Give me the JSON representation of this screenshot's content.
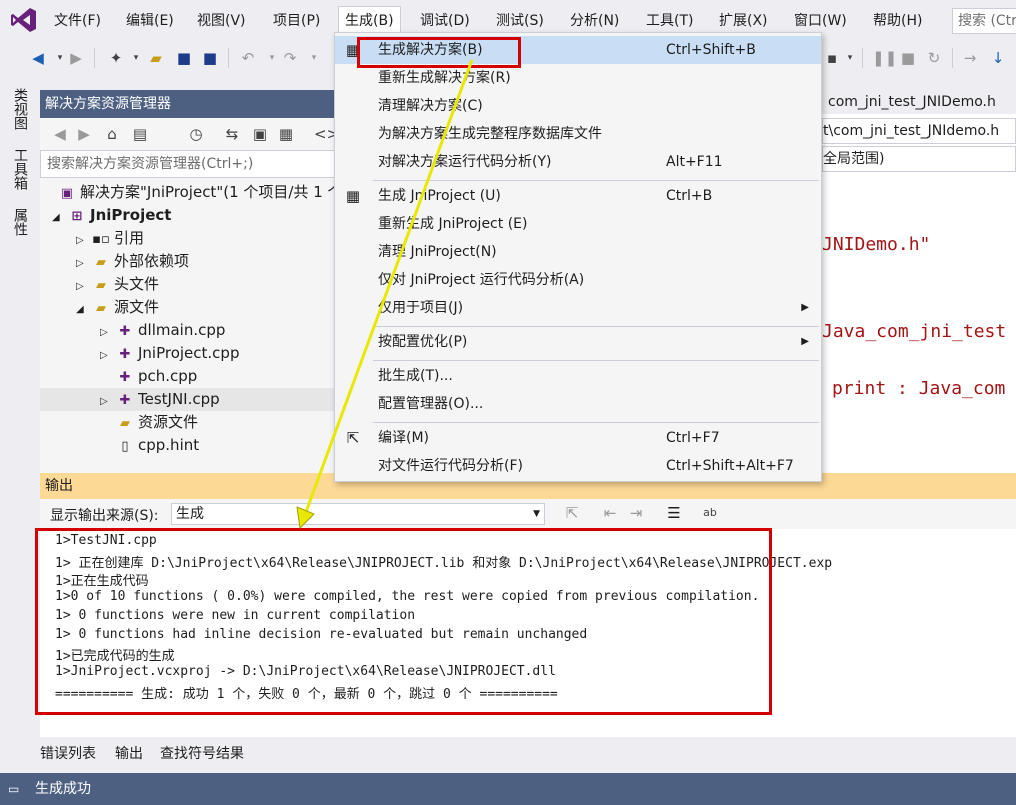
{
  "menubar": {
    "items": [
      "文件(F)",
      "编辑(E)",
      "视图(V)",
      "项目(P)",
      "生成(B)",
      "调试(D)",
      "测试(S)",
      "分析(N)",
      "工具(T)",
      "扩展(X)",
      "窗口(W)",
      "帮助(H)"
    ],
    "search_placeholder": "搜索 (Ctr"
  },
  "left_strip": {
    "tabs": [
      "类视图",
      "工具箱",
      "属性"
    ]
  },
  "solution_explorer": {
    "title": "解决方案资源管理器",
    "search_placeholder": "搜索解决方案资源管理器(Ctrl+;)",
    "solution": "解决方案\"JniProject\"(1 个项目/共 1 个",
    "project": "JniProject",
    "items": {
      "references": "引用",
      "external_deps": "外部依赖项",
      "headers": "头文件",
      "sources": "源文件",
      "dllmain": "dllmain.cpp",
      "jniproject": "JniProject.cpp",
      "pch": "pch.cpp",
      "testjni": "TestJNI.cpp",
      "resources": "资源文件",
      "hint": "cpp.hint"
    }
  },
  "editor": {
    "tab": "com_jni_test_JNIDemo.h",
    "path": "t\\com_jni_test_JNIdemo.h",
    "scope": "全局范围)",
    "code": [
      "JNIDemo.h\"",
      "Java_com_jni_test",
      "print : Java_com"
    ]
  },
  "build_menu": {
    "items": [
      {
        "label": "生成解决方案(B)",
        "shortcut": "Ctrl+Shift+B"
      },
      {
        "label": "重新生成解决方案(R)",
        "shortcut": ""
      },
      {
        "label": "清理解决方案(C)",
        "shortcut": ""
      },
      {
        "label": "为解决方案生成完整程序数据库文件",
        "shortcut": ""
      },
      {
        "label": "对解决方案运行代码分析(Y)",
        "shortcut": "Alt+F11"
      },
      {
        "label": "生成 JniProject (U)",
        "shortcut": "Ctrl+B"
      },
      {
        "label": "重新生成 JniProject (E)",
        "shortcut": ""
      },
      {
        "label": "清理 JniProject(N)",
        "shortcut": ""
      },
      {
        "label": "仅对 JniProject 运行代码分析(A)",
        "shortcut": ""
      },
      {
        "label": "仅用于项目(J)",
        "shortcut": ""
      },
      {
        "label": "按配置优化(P)",
        "shortcut": ""
      },
      {
        "label": "批生成(T)...",
        "shortcut": ""
      },
      {
        "label": "配置管理器(O)...",
        "shortcut": ""
      },
      {
        "label": "编译(M)",
        "shortcut": "Ctrl+F7"
      },
      {
        "label": "对文件运行代码分析(F)",
        "shortcut": "Ctrl+Shift+Alt+F7"
      }
    ]
  },
  "output": {
    "title": "输出",
    "source_label": "显示输出来源(S):",
    "source_value": "生成",
    "lines": [
      "1>TestJNI.cpp",
      "1>  正在创建库 D:\\JniProject\\x64\\Release\\JNIPROJECT.lib 和对象 D:\\JniProject\\x64\\Release\\JNIPROJECT.exp",
      "1>正在生成代码",
      "1>0 of 10 functions ( 0.0%) were compiled, the rest were copied from previous compilation.",
      "1>  0 functions were new in current compilation",
      "1>  0 functions had inline decision re-evaluated but remain unchanged",
      "1>已完成代码的生成",
      "1>JniProject.vcxproj -> D:\\JniProject\\x64\\Release\\JNIPROJECT.dll",
      "========== 生成: 成功 1 个，失败 0 个，最新 0 个，跳过 0 个 =========="
    ]
  },
  "bottom_tabs": [
    "错误列表",
    "输出",
    "查找符号结果"
  ],
  "statusbar": {
    "text": "生成成功"
  },
  "colors": {
    "accent": "#4d6082",
    "output_title": "#fdd996",
    "highlight": "#c9def5",
    "annotation": "#d40000",
    "arrow": "#e8e800"
  }
}
